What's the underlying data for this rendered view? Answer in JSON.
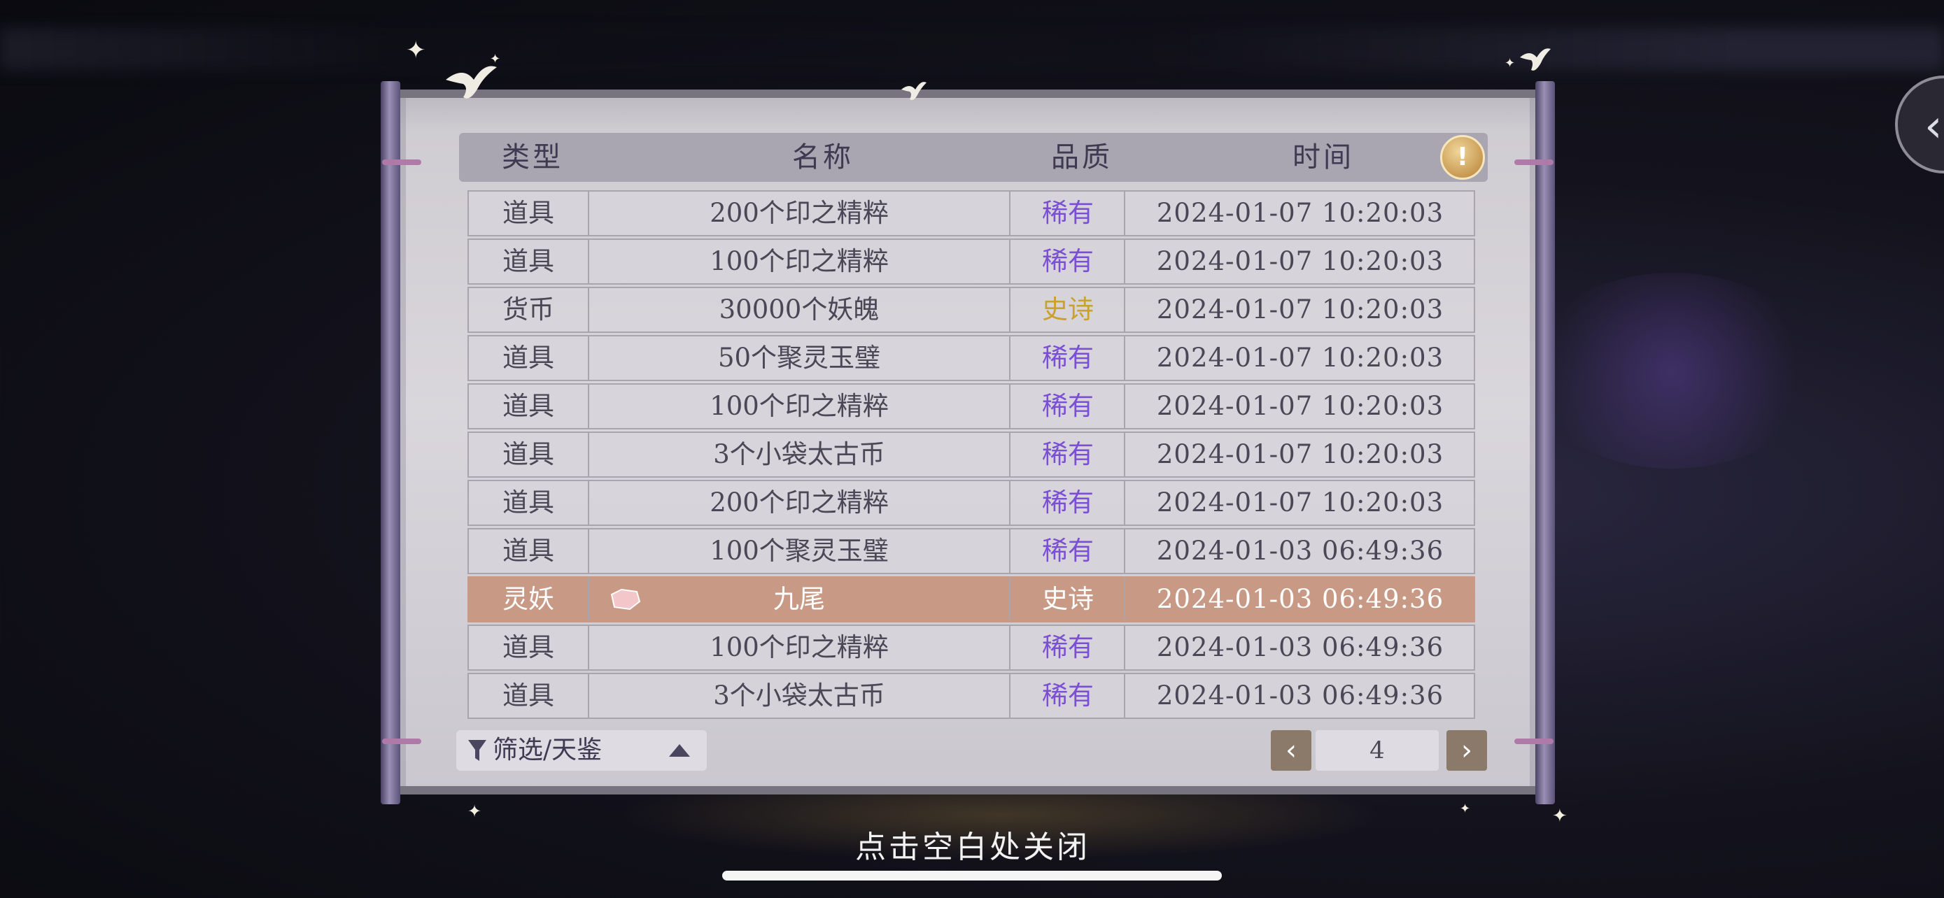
{
  "table": {
    "headers": {
      "type": "类型",
      "name": "名称",
      "quality": "品质",
      "time": "时间"
    },
    "rows": [
      {
        "type": "道具",
        "name": "200个印之精粹",
        "quality": "稀有",
        "time": "2024-01-07  10:20:03"
      },
      {
        "type": "道具",
        "name": "100个印之精粹",
        "quality": "稀有",
        "time": "2024-01-07  10:20:03"
      },
      {
        "type": "货币",
        "name": "30000个妖魄",
        "quality": "史诗",
        "time": "2024-01-07  10:20:03"
      },
      {
        "type": "道具",
        "name": "50个聚灵玉璧",
        "quality": "稀有",
        "time": "2024-01-07  10:20:03"
      },
      {
        "type": "道具",
        "name": "100个印之精粹",
        "quality": "稀有",
        "time": "2024-01-07  10:20:03"
      },
      {
        "type": "道具",
        "name": "3个小袋太古币",
        "quality": "稀有",
        "time": "2024-01-07  10:20:03"
      },
      {
        "type": "道具",
        "name": "200个印之精粹",
        "quality": "稀有",
        "time": "2024-01-07  10:20:03"
      },
      {
        "type": "道具",
        "name": "100个聚灵玉璧",
        "quality": "稀有",
        "time": "2024-01-03  06:49:36"
      },
      {
        "type": "灵妖",
        "name": "九尾",
        "quality": "史诗",
        "time": "2024-01-03  06:49:36"
      },
      {
        "type": "道具",
        "name": "100个印之精粹",
        "quality": "稀有",
        "time": "2024-01-03  06:49:36"
      },
      {
        "type": "道具",
        "name": "3个小袋太古币",
        "quality": "稀有",
        "time": "2024-01-03  06:49:36"
      }
    ]
  },
  "filter": {
    "label": "筛选/天鉴"
  },
  "pagination": {
    "current": "4",
    "prev_icon": "chevron-left-icon",
    "next_icon": "chevron-right-icon"
  },
  "footer": {
    "close_hint": "点击空白处关闭"
  },
  "icons": {
    "hint": "lightbulb-icon",
    "back": "chevron-left-icon",
    "filter": "funnel-icon",
    "pet": "gem-icon"
  },
  "colors": {
    "rare": "#7a4fd6",
    "epic": "#c9a22c",
    "highlight_row": "#c89a86"
  }
}
